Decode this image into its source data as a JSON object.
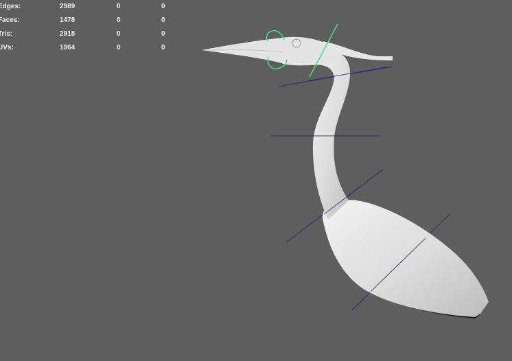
{
  "viewport": {
    "background_color": "#5e5e5e"
  },
  "hud": {
    "rows": [
      {
        "label": "Edges:",
        "values": [
          "2989",
          "0",
          "0"
        ]
      },
      {
        "label": "Faces:",
        "values": [
          "1478",
          "0",
          "0"
        ]
      },
      {
        "label": "Tris:",
        "values": [
          "2918",
          "0",
          "0"
        ]
      },
      {
        "label": "UVs:",
        "values": [
          "1964",
          "0",
          "0"
        ]
      }
    ]
  },
  "scene": {
    "model": "heron-mesh",
    "colors": {
      "mesh": "#d9d9d9",
      "cross_section_curves": "#2e2a78",
      "selected_curve": "#3bea7a"
    }
  }
}
